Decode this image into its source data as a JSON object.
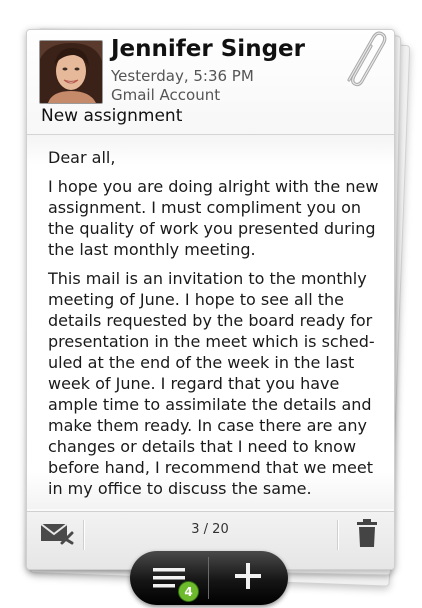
{
  "email": {
    "sender": "Jennifer Singer",
    "timestamp": "Yesterday, 5:36 PM",
    "account": "Gmail Account",
    "subject": "New assignment",
    "body": [
      "Dear all,",
      "I hope you are doing alright with the new assignment. I must compliment you on the quality of work you presented during the last monthly meeting.",
      "This mail is an invitation to the monthly meeting of June. I hope to see all the details requested by the board ready for presentation in the meet which is sched-uled at the end of the week in the last week of June. I regard that you have ample time to assimilate the details and make them ready. In case there are any changes or details that I need to know before hand, I recommend that we meet in my office to discuss the same."
    ]
  },
  "footer": {
    "pager": "3 / 20",
    "left_icon": "mail-unread-icon",
    "right_icon": "trash-icon"
  },
  "bottom_bar": {
    "list_icon": "message-list-icon",
    "badge_count": "4",
    "compose_icon": "plus-icon"
  },
  "colors": {
    "badge": "#6dbb2c",
    "bar": "#1a1a1a"
  }
}
